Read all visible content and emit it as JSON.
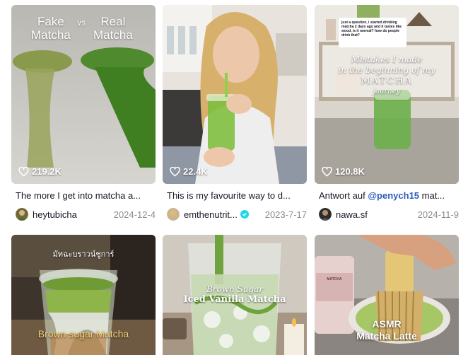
{
  "videos": [
    {
      "overlay_left": "Fake\nMatcha",
      "overlay_vs": "vs",
      "overlay_right": "Real\nMatcha",
      "likes": "219.2K",
      "caption": "The more I get into matcha a...",
      "author": "heytubicha",
      "verified": false,
      "date": "2024-12-4"
    },
    {
      "likes": "22.4K",
      "caption": "This is my favourite way to d...",
      "author": "emthenutrit...",
      "verified": true,
      "date": "2023-7-17"
    },
    {
      "comment_text": "just a question, i started drinking matcha 2 days ago and it tastes like wood, is it normal? how do people drink that?",
      "overlay_line1": "Mistakes I made",
      "overlay_line2": "in the beginning of my",
      "overlay_line3": "MATCHA",
      "overlay_line4": "journey",
      "likes": "120.8K",
      "caption_prefix": "Antwort auf ",
      "caption_mention": "@penych15",
      "caption_suffix": " mat...",
      "author": "nawa.sf",
      "verified": false,
      "date": "2024-11-9"
    },
    {
      "overlay_top": "มัทฉะบราวน์ชูการ์",
      "overlay_bottom": "Brown sugar Matcha"
    },
    {
      "overlay_line1": "Brown Sugar",
      "overlay_line2": "Iced Vanilla Matcha"
    },
    {
      "tin_label": "MATCHA",
      "overlay_line1": "ASMR",
      "overlay_line2": "Matcha Latte"
    }
  ],
  "colors": {
    "accent_verified": "#20d5ec",
    "mention": "#2b5db9",
    "date": "#8a8b91"
  },
  "icons": {
    "likes": "heart-outline-icon",
    "verified": "check-badge-icon"
  }
}
